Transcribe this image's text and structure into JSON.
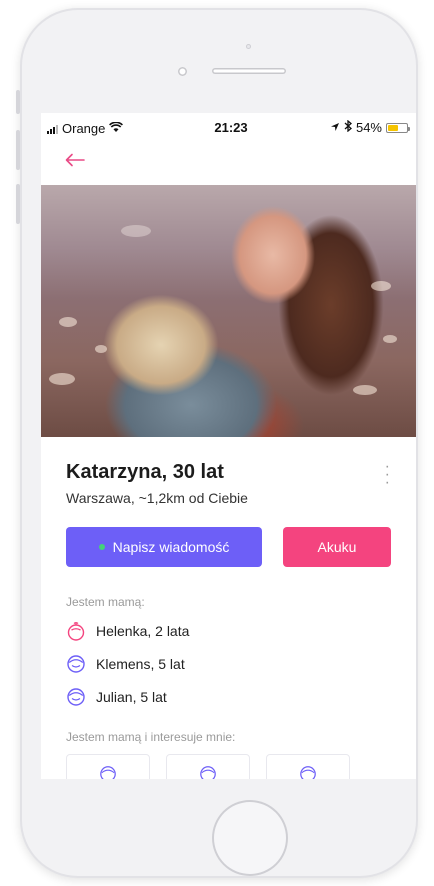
{
  "status_bar": {
    "carrier": "Orange",
    "time": "21:23",
    "battery": "54%",
    "battery_level": 0.54
  },
  "nav": {
    "back_icon": "arrow-left-icon"
  },
  "profile": {
    "name": "Katarzyna, 30 lat",
    "location": "Warszawa, ~1,2km od Ciebie",
    "more_icon": "more-vertical-icon"
  },
  "actions": {
    "message_label": "Napisz wiadomość",
    "akuku_label": "Akuku"
  },
  "children_section": {
    "title": "Jestem mamą:",
    "children": [
      {
        "name": "Helenka, 2 lata",
        "icon": "girl-face-icon"
      },
      {
        "name": "Klemens, 5 lat",
        "icon": "boy-face-icon"
      },
      {
        "name": "Julian, 5 lat",
        "icon": "boy-face-icon"
      }
    ]
  },
  "interests_section": {
    "title": "Jestem mamą i interesuje mnie:"
  },
  "colors": {
    "accent_purple": "#6d5ff7",
    "accent_pink": "#f4447f",
    "status_green": "#43d17a"
  }
}
